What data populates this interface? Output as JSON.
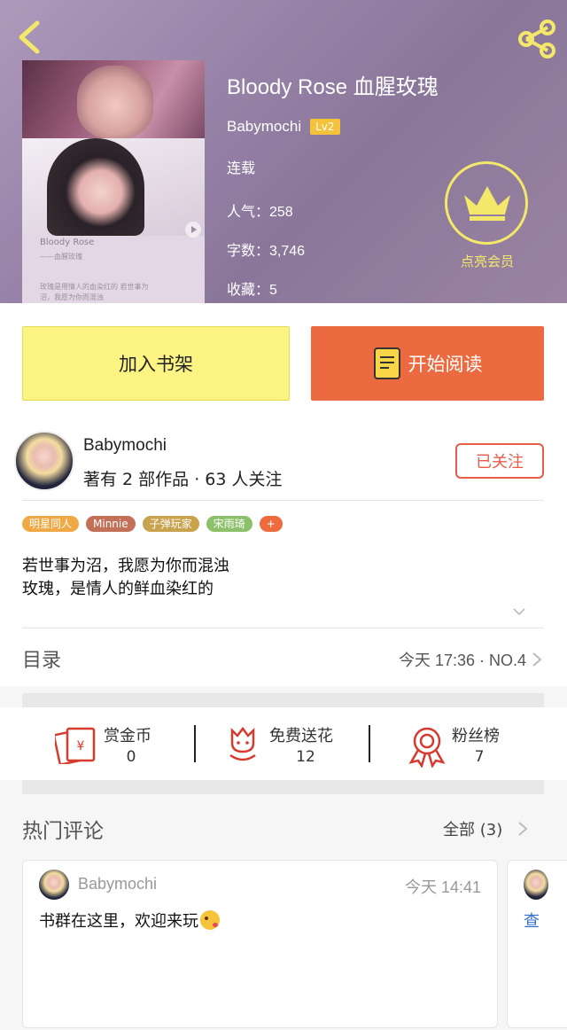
{
  "header": {
    "book_title": "Bloody Rose 血腥玫瑰",
    "author": "Babymochi",
    "level": "Lv2",
    "status": "连载",
    "popularity": "人气：258",
    "word_count": "字数：3,746",
    "favorites": "收藏：5",
    "vip_label": "点亮会员"
  },
  "cover": {
    "title": "Bloody Rose",
    "subtitle": "——血腥玫瑰",
    "blurb": "玫瑰是用情人的血染红的 若世事为沼，我愿为你而混浊"
  },
  "actions": {
    "add_shelf": "加入书架",
    "start_reading": "开始阅读"
  },
  "author_section": {
    "name": "Babymochi",
    "stats": "著有 2 部作品 · 63 人关注",
    "follow_label": "已关注",
    "tags": [
      {
        "label": "明星同人",
        "color": "#f0a845"
      },
      {
        "label": "Minnie",
        "color": "#c37059"
      },
      {
        "label": "子弹玩家",
        "color": "#c9a24d"
      },
      {
        "label": "宋雨琦",
        "color": "#8cc06b"
      },
      {
        "label": "+",
        "color": "#ef6a3c"
      }
    ],
    "description": [
      "若世事为沼，我愿为你而混浊",
      "玫瑰，是情人的鲜血染红的"
    ]
  },
  "catalog": {
    "label": "目录",
    "latest": "今天 17:36 · NO.4"
  },
  "stats": [
    {
      "label": "赏金币",
      "value": "0",
      "icon": "red-envelope-icon"
    },
    {
      "label": "免费送花",
      "value": "12",
      "icon": "flower-icon"
    },
    {
      "label": "粉丝榜",
      "value": "7",
      "icon": "ribbon-medal-icon"
    }
  ],
  "comments": {
    "title": "热门评论",
    "all_label": "全部 (3)",
    "items": [
      {
        "user": "Babymochi",
        "time": "今天 14:41",
        "text": "书群在这里，欢迎来玩"
      }
    ],
    "peek_text": "查"
  }
}
